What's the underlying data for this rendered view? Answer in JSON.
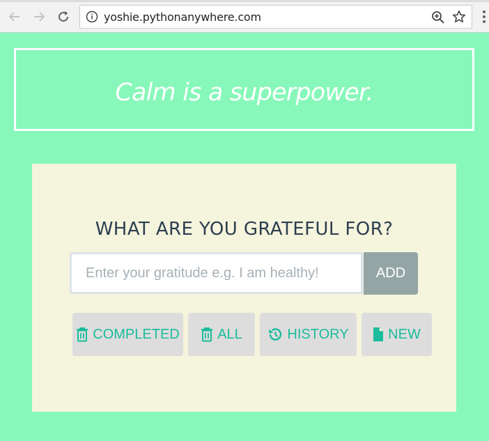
{
  "browser": {
    "url": "yoshie.pythonanywhere.com",
    "icons": [
      "back-arrow-icon",
      "forward-arrow-icon",
      "reload-icon",
      "info-icon",
      "zoom-icon",
      "star-icon",
      "menu-icon"
    ]
  },
  "hero": {
    "quote": "Calm is a superpower."
  },
  "card": {
    "heading": "WHAT ARE YOU GRATEFUL FOR?",
    "input": {
      "placeholder": "Enter your gratitude e.g. I am healthy!",
      "value": ""
    },
    "add_label": "ADD",
    "actions": [
      {
        "label": "COMPLETED",
        "icon": "trash-icon"
      },
      {
        "label": "ALL",
        "icon": "trash-icon"
      },
      {
        "label": "HISTORY",
        "icon": "history-icon"
      },
      {
        "label": "NEW",
        "icon": "file-icon"
      }
    ]
  },
  "colors": {
    "page_background": "#87f8b9",
    "card_background": "#f5f4dc",
    "accent": "#1abc9c",
    "heading": "#2c3e50",
    "add_button": "#95a5a6",
    "action_button": "#dddddd"
  }
}
